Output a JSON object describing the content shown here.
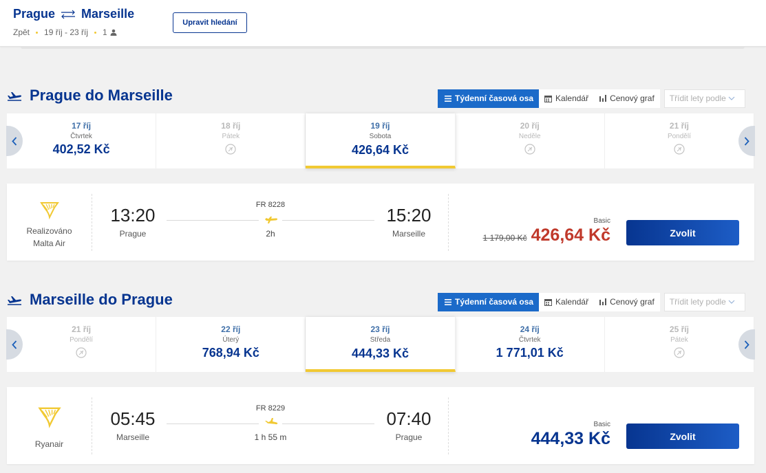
{
  "header": {
    "origin": "Prague",
    "destination": "Marseille",
    "back_link": "Zpět",
    "dates": "19 říj - 23 říj",
    "passengers": "1",
    "edit_button": "Upravit hledání",
    "icons": [
      "swap-arrows-icon",
      "person-icon"
    ]
  },
  "view_options": {
    "weekly": "Týdenní časová osa",
    "calendar": "Kalendář",
    "price_chart": "Cenový graf",
    "sort_placeholder": "Třídit lety podle"
  },
  "outbound": {
    "title": "Prague do Marseille",
    "days": [
      {
        "date": "17 říj",
        "weekday": "Čtvrtek",
        "price": "402,52 Kč",
        "available": true,
        "selected": false
      },
      {
        "date": "18 říj",
        "weekday": "Pátek",
        "price": "",
        "available": false,
        "selected": false
      },
      {
        "date": "19 říj",
        "weekday": "Sobota",
        "price": "426,64 Kč",
        "available": true,
        "selected": true
      },
      {
        "date": "20 říj",
        "weekday": "Neděle",
        "price": "",
        "available": false,
        "selected": false
      },
      {
        "date": "21 říj",
        "weekday": "Pondělí",
        "price": "",
        "available": false,
        "selected": false
      }
    ],
    "flight": {
      "carrier_line1": "Realizováno",
      "carrier_line2": "Malta Air",
      "dep_time": "13:20",
      "dep_city": "Prague",
      "flight_no": "FR 8228",
      "duration": "2h",
      "arr_time": "15:20",
      "arr_city": "Marseille",
      "fare_type": "Basic",
      "old_price": "1 179,00 Kč",
      "price": "426,64 Kč",
      "choose": "Zvolit"
    }
  },
  "inbound": {
    "title": "Marseille do Prague",
    "days": [
      {
        "date": "21 říj",
        "weekday": "Pondělí",
        "price": "",
        "available": false,
        "selected": false
      },
      {
        "date": "22 říj",
        "weekday": "Úterý",
        "price": "768,94 Kč",
        "available": true,
        "selected": false
      },
      {
        "date": "23 říj",
        "weekday": "Středa",
        "price": "444,33 Kč",
        "available": true,
        "selected": true
      },
      {
        "date": "24 říj",
        "weekday": "Čtvrtek",
        "price": "1 771,01 Kč",
        "available": true,
        "selected": false
      },
      {
        "date": "25 říj",
        "weekday": "Pátek",
        "price": "",
        "available": false,
        "selected": false
      }
    ],
    "flight": {
      "carrier_line1": "Ryanair",
      "dep_time": "05:45",
      "dep_city": "Marseille",
      "flight_no": "FR 8229",
      "duration": "1 h 55 m",
      "arr_time": "07:40",
      "arr_city": "Prague",
      "fare_type": "Basic",
      "price": "444,33 Kč",
      "choose": "Zvolit"
    }
  },
  "colors": {
    "brand_blue": "#073590",
    "accent_yellow": "#f1c933",
    "price_red": "#c0392b",
    "active_tab": "#1b6ac9"
  }
}
